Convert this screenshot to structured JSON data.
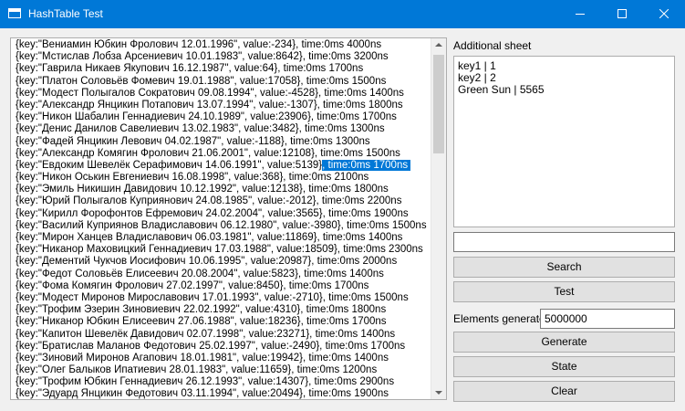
{
  "window": {
    "title": "HashTable Test",
    "close_glyph": "✕"
  },
  "list": {
    "selected_index": 11,
    "rows": [
      {
        "main": "{key:\"Вениамин Юбкин Фролович 12.01.1996\", value:-234}, time:0ms 4000ns",
        "selected": ""
      },
      {
        "main": "{key:\"Мстислав Лобза Арсениевич 10.01.1983\", value:8642}, time:0ms 3200ns",
        "selected": ""
      },
      {
        "main": "{key:\"Гаврила Никаев Якупович 16.12.1987\", value:64}, time:0ms 1700ns",
        "selected": ""
      },
      {
        "main": "{key:\"Платон Соловьёв Фомевич 19.01.1988\", value:17058}, time:0ms 1500ns",
        "selected": ""
      },
      {
        "main": "{key:\"Модест Полыгалов Сократович 09.08.1994\", value:-4528}, time:0ms 1400ns",
        "selected": ""
      },
      {
        "main": "{key:\"Александр Янцикин Потапович 13.07.1994\", value:-1307}, time:0ms 1800ns",
        "selected": ""
      },
      {
        "main": "{key:\"Никон Шабалин Геннадиевич 24.10.1989\", value:23906}, time:0ms 1700ns",
        "selected": ""
      },
      {
        "main": "{key:\"Денис Данилов Савелиевич 13.02.1983\", value:3482}, time:0ms 1300ns",
        "selected": ""
      },
      {
        "main": "{key:\"Фадей Янцикин Левович 04.02.1987\", value:-1188}, time:0ms 1300ns",
        "selected": ""
      },
      {
        "main": "{key:\"Александр Комягин Фролович 21.06.2001\", value:12108}, time:0ms 1500ns",
        "selected": ""
      },
      {
        "main": "{key:\"Евдоким Шевелёк Серафимович 14.06.1991\", value:5139}",
        "selected": ", time:0ms 1700ns"
      },
      {
        "main": "{key:\"Никон Оськин Евгениевич 16.08.1998\", value:368}, time:0ms 2100ns",
        "selected": ""
      },
      {
        "main": "{key:\"Эмиль Никишин Давидович 10.12.1992\", value:12138}, time:0ms 1800ns",
        "selected": ""
      },
      {
        "main": "{key:\"Юрий Полыгалов Куприянович 24.08.1985\", value:-2012}, time:0ms 2200ns",
        "selected": ""
      },
      {
        "main": "{key:\"Кирилл Форофонтов Ефремович 24.02.2004\", value:3565}, time:0ms 1900ns",
        "selected": ""
      },
      {
        "main": "{key:\"Василий Куприянов Владиславович 06.12.1980\", value:-3980}, time:0ms 1500ns",
        "selected": ""
      },
      {
        "main": "{key:\"Мирон Ханцев Владиславович 06.03.1981\", value:11869}, time:0ms 1400ns",
        "selected": ""
      },
      {
        "main": "{key:\"Никанор Маховицкий Геннадиевич 17.03.1988\", value:18509}, time:0ms 2300ns",
        "selected": ""
      },
      {
        "main": "{key:\"Дементий Чукчов Иосифович 10.06.1995\", value:20987}, time:0ms 2000ns",
        "selected": ""
      },
      {
        "main": "{key:\"Федот Соловьёв Елисеевич 20.08.2004\", value:5823}, time:0ms 1400ns",
        "selected": ""
      },
      {
        "main": "{key:\"Фома Комягин Фролович 27.02.1997\", value:8450}, time:0ms 1700ns",
        "selected": ""
      },
      {
        "main": "{key:\"Модест Миронов Мирославович 17.01.1993\", value:-2710}, time:0ms 1500ns",
        "selected": ""
      },
      {
        "main": "{key:\"Трофим Эзерин Зиновиевич 22.02.1992\", value:4310}, time:0ms 1800ns",
        "selected": ""
      },
      {
        "main": "{key:\"Никанор Юбкин Елисеевич 27.06.1988\", value:18236}, time:0ms 1700ns",
        "selected": ""
      },
      {
        "main": "{key:\"Капитон Шевелёк Давидович 02.07.1998\", value:23271}, time:0ms 1400ns",
        "selected": ""
      },
      {
        "main": "{key:\"Братислав Маланов Федотович 25.02.1997\", value:-2490}, time:0ms 1700ns",
        "selected": ""
      },
      {
        "main": "{key:\"Зиновий Миронов Агапович 18.01.1981\", value:19942}, time:0ms 1400ns",
        "selected": ""
      },
      {
        "main": "{key:\"Олег Балыков Ипатиевич 28.01.1983\", value:11659}, time:0ms 1200ns",
        "selected": ""
      },
      {
        "main": "{key:\"Трофим Юбкин Геннадиевич 26.12.1993\", value:14307}, time:0ms 2900ns",
        "selected": ""
      },
      {
        "main": "{key:\"Эдуард Янцикин Федотович 03.11.1994\", value:20494}, time:0ms 1900ns",
        "selected": ""
      }
    ]
  },
  "sheet": {
    "label": "Additional sheet",
    "lines": [
      "key1 | 1",
      "key2 | 2",
      "Green Sun | 5565"
    ]
  },
  "search": {
    "value": ""
  },
  "buttons": {
    "search": "Search",
    "test": "Test",
    "generate": "Generate",
    "state": "State",
    "clear": "Clear"
  },
  "generate": {
    "label": "Elements generate",
    "value": "5000000"
  }
}
